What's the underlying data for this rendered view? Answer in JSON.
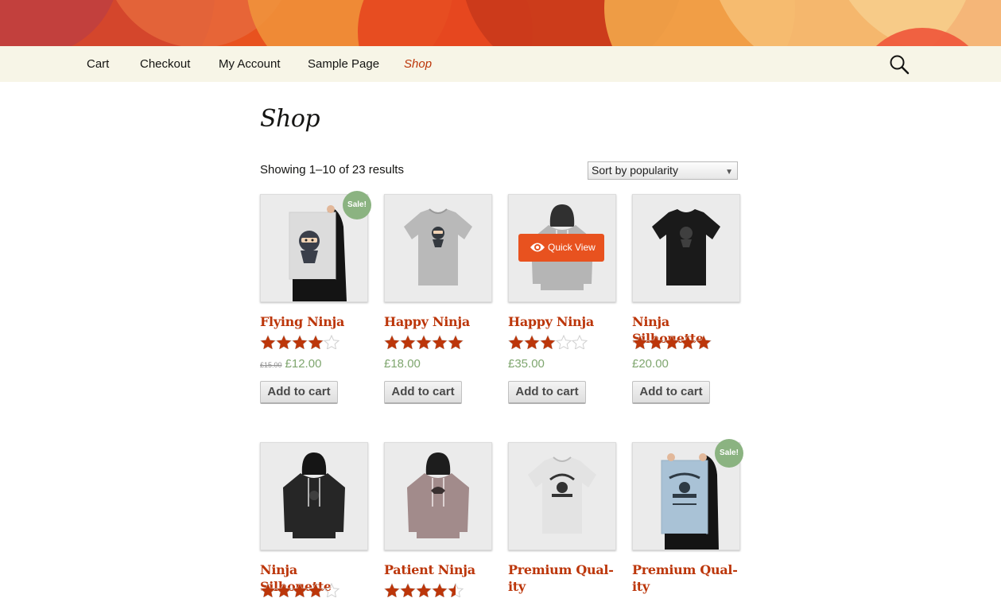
{
  "nav": {
    "items": [
      {
        "label": "Cart"
      },
      {
        "label": "Checkout"
      },
      {
        "label": "My Account"
      },
      {
        "label": "Sample Page"
      },
      {
        "label": "Shop",
        "current": true
      }
    ],
    "search_icon": "search-icon"
  },
  "page": {
    "title": "Shop",
    "result_count": "Showing 1–10 of 23 results",
    "sort_value": "Sort by popularity"
  },
  "colors": {
    "accent": "#bc360a",
    "header": "#e8521f",
    "nav_bg": "#f7f5e7",
    "price": "#7fa66f",
    "sale_badge": "#8bb381"
  },
  "products": [
    {
      "title": "Flying Ninja",
      "rating": 4,
      "old_price": "£15.00",
      "price": "£12.00",
      "sale": true,
      "sale_label": "Sale!",
      "button": "Add to cart",
      "image": "ninja-poster"
    },
    {
      "title": "Happy Ninja",
      "rating": 5,
      "price": "£18.00",
      "button": "Add to cart",
      "image": "grey-tshirt"
    },
    {
      "title": "Happy Ninja",
      "rating": 3,
      "price": "£35.00",
      "button": "Add to cart",
      "image": "grey-hoodie",
      "quick_view": "Quick View"
    },
    {
      "title": "Ninja Silhouette",
      "rating": 5,
      "price": "£20.00",
      "button": "Add to cart",
      "image": "black-tshirt"
    },
    {
      "title": "Ninja Silhouette",
      "rating": 4,
      "image": "black-hoodie"
    },
    {
      "title": "Patient Ninja",
      "rating": 4.5,
      "image": "mauve-hoodie"
    },
    {
      "title": "Premium Qual-ity",
      "image": "white-tshirt"
    },
    {
      "title": "Premium Qual-ity",
      "sale": true,
      "sale_label": "Sale!",
      "image": "blue-poster"
    }
  ]
}
